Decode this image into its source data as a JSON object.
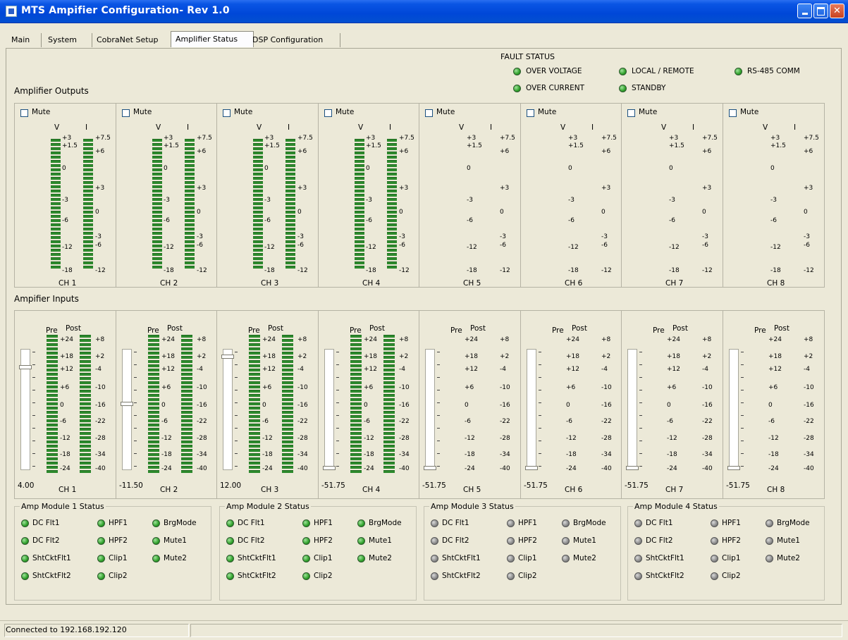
{
  "window": {
    "title": "MTS Ampifier Configuration- Rev 1.0",
    "min_icon": "minimize-icon",
    "max_icon": "maximize-icon",
    "close_icon": "close-icon",
    "close_glyph": "✕"
  },
  "tabs": [
    {
      "label": "Main"
    },
    {
      "label": "System"
    },
    {
      "label": "CobraNet Setup"
    },
    {
      "label": "Amplifier Status"
    },
    {
      "label": "DSP Configuration"
    }
  ],
  "active_tab": "Amplifier Status",
  "fault": {
    "title": "FAULT STATUS",
    "items": [
      {
        "label": "OVER VOLTAGE",
        "state": "on"
      },
      {
        "label": "LOCAL / REMOTE",
        "state": "on"
      },
      {
        "label": "RS-485 COMM",
        "state": "on"
      },
      {
        "label": "OVER CURRENT",
        "state": "on"
      },
      {
        "label": "STANDBY",
        "state": "on"
      }
    ]
  },
  "outputs": {
    "title": "Amplifier Outputs",
    "mute_label": "Mute",
    "v_header": "V",
    "i_header": "I",
    "v_ticks": [
      "+3",
      "+1.5",
      "0",
      "-3",
      "-6",
      "-12",
      "-18"
    ],
    "i_ticks": [
      "+7.5",
      "+6",
      "+3",
      "0",
      "-3",
      "-6",
      "-12"
    ],
    "channels": [
      {
        "label": "CH 1",
        "meters_visible": true
      },
      {
        "label": "CH 2",
        "meters_visible": true
      },
      {
        "label": "CH 3",
        "meters_visible": true
      },
      {
        "label": "CH 4",
        "meters_visible": true
      },
      {
        "label": "CH 5",
        "meters_visible": false
      },
      {
        "label": "CH 6",
        "meters_visible": false
      },
      {
        "label": "CH 7",
        "meters_visible": false
      },
      {
        "label": "CH 8",
        "meters_visible": false
      }
    ]
  },
  "inputs": {
    "title": "Ampifier Inputs",
    "pre_header": "Pre",
    "post_header": "Post",
    "pre_ticks": [
      "+24",
      "+18",
      "+12",
      "+6",
      "0",
      "-6",
      "-12",
      "-18",
      "-24"
    ],
    "post_ticks": [
      "+8",
      "+2",
      "-4",
      "-10",
      "-16",
      "-22",
      "-28",
      "-34",
      "-40"
    ],
    "channels": [
      {
        "label": "CH 1",
        "value": "4.00",
        "fader_level": 0.86,
        "meters_visible": true
      },
      {
        "label": "CH 2",
        "value": "-11.50",
        "fader_level": 0.55,
        "meters_visible": true
      },
      {
        "label": "CH 3",
        "value": "12.00",
        "fader_level": 0.95,
        "meters_visible": true
      },
      {
        "label": "CH 4",
        "value": "-51.75",
        "fader_level": 0.0,
        "meters_visible": true
      },
      {
        "label": "CH 5",
        "value": "-51.75",
        "fader_level": 0.0,
        "meters_visible": false
      },
      {
        "label": "CH 6",
        "value": "-51.75",
        "fader_level": 0.0,
        "meters_visible": false
      },
      {
        "label": "CH 7",
        "value": "-51.75",
        "fader_level": 0.0,
        "meters_visible": false
      },
      {
        "label": "CH 8",
        "value": "-51.75",
        "fader_level": 0.0,
        "meters_visible": false
      }
    ]
  },
  "modules": [
    {
      "title": "Amp Module 1 Status",
      "state": "on",
      "items": [
        "DC Flt1",
        "DC Flt2",
        "ShtCktFlt1",
        "ShtCktFlt2",
        "HPF1",
        "HPF2",
        "Clip1",
        "Clip2",
        "BrgMode",
        "Mute1",
        "Mute2"
      ]
    },
    {
      "title": "Amp Module 2 Status",
      "state": "on",
      "items": [
        "DC Flt1",
        "DC Flt2",
        "ShtCktFlt1",
        "ShtCktFlt2",
        "HPF1",
        "HPF2",
        "Clip1",
        "Clip2",
        "BrgMode",
        "Mute1",
        "Mute2"
      ]
    },
    {
      "title": "Amp Module 3 Status",
      "state": "off",
      "items": [
        "DC Flt1",
        "DC Flt2",
        "ShtCktFlt1",
        "ShtCktFlt2",
        "HPF1",
        "HPF2",
        "Clip1",
        "Clip2",
        "BrgMode",
        "Mute1",
        "Mute2"
      ]
    },
    {
      "title": "Amp Module 4 Status",
      "state": "off",
      "items": [
        "DC Flt1",
        "DC Flt2",
        "ShtCktFlt1",
        "ShtCktFlt2",
        "HPF1",
        "HPF2",
        "Clip1",
        "Clip2",
        "BrgMode",
        "Mute1",
        "Mute2"
      ]
    }
  ],
  "statusbar": {
    "text": "Connected to 192.168.192.120"
  },
  "colors": {
    "titlebar": "#0a55e4",
    "led_on": "#2fa02a",
    "led_off": "#8a8a8a",
    "meter": "#2d8a2d",
    "panel_bg": "#ece9d8"
  }
}
